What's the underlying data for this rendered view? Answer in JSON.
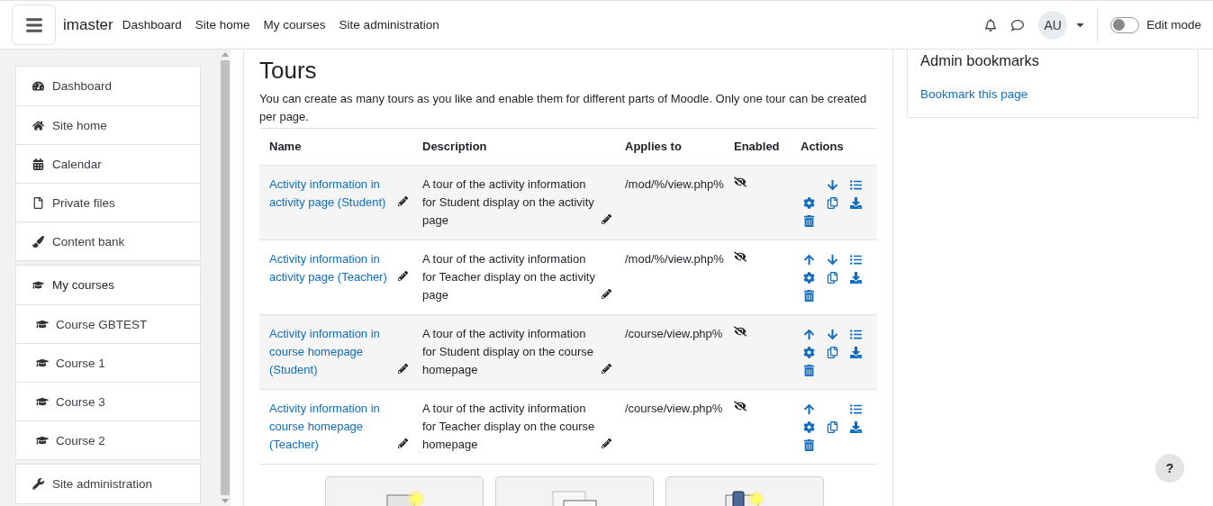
{
  "navbar": {
    "brand": "imaster",
    "links": [
      "Dashboard",
      "Site home",
      "My courses",
      "Site administration"
    ],
    "user_initials": "AU",
    "edit_mode": {
      "label": "Edit mode",
      "on": false
    }
  },
  "sidebar": {
    "groups": [
      {
        "items": [
          {
            "label": "Dashboard"
          },
          {
            "label": "Site home"
          },
          {
            "label": "Calendar"
          },
          {
            "label": "Private files"
          },
          {
            "label": "Content bank"
          }
        ]
      },
      {
        "items": [
          {
            "label": "My courses",
            "children": [
              {
                "label": "Course GBTEST"
              },
              {
                "label": "Course 1"
              },
              {
                "label": "Course 3"
              },
              {
                "label": "Course 2"
              }
            ]
          }
        ]
      },
      {
        "items": [
          {
            "label": "Site administration"
          }
        ]
      }
    ]
  },
  "page": {
    "title": "Tours",
    "intro": "You can create as many tours as you like and enable them for different parts of Moodle. Only one tour can be created per page.",
    "table": {
      "columns": [
        "Name",
        "Description",
        "Applies to",
        "Enabled",
        "Actions"
      ],
      "rows": [
        {
          "name": "Activity information in activity page (Student)",
          "description": "A tour of the activity information for Student display on the activity page",
          "applies_to": "/mod/%/view.php%",
          "enabled": false,
          "actions": [
            {
              "kind": "down"
            },
            {
              "kind": "list"
            },
            {
              "kind": "gear"
            },
            {
              "kind": "copy"
            },
            {
              "kind": "download"
            },
            {
              "kind": "trash"
            }
          ]
        },
        {
          "name": "Activity information in activity page (Teacher)",
          "description": "A tour of the activity information for Teacher display on the activity page",
          "applies_to": "/mod/%/view.php%",
          "enabled": false,
          "actions": [
            {
              "kind": "up"
            },
            {
              "kind": "down"
            },
            {
              "kind": "list"
            },
            {
              "kind": "gear"
            },
            {
              "kind": "copy"
            },
            {
              "kind": "download"
            },
            {
              "kind": "trash"
            }
          ]
        },
        {
          "name": "Activity information in course homepage (Student)",
          "description": "A tour of the activity information for Student display on the course homepage",
          "applies_to": "/course/view.php%",
          "enabled": false,
          "actions": [
            {
              "kind": "up"
            },
            {
              "kind": "down"
            },
            {
              "kind": "list"
            },
            {
              "kind": "gear"
            },
            {
              "kind": "copy"
            },
            {
              "kind": "download"
            },
            {
              "kind": "trash"
            }
          ]
        },
        {
          "name": "Activity information in course homepage (Teacher)",
          "description": "A tour of the activity information for Teacher display on the course homepage",
          "applies_to": "/course/view.php%",
          "enabled": false,
          "actions": [
            {
              "kind": "up"
            },
            {
              "kind": "list"
            },
            {
              "kind": "gear"
            },
            {
              "kind": "copy"
            },
            {
              "kind": "download"
            },
            {
              "kind": "trash"
            }
          ]
        }
      ]
    },
    "tiles": [
      {
        "kind": "new"
      },
      {
        "kind": "import"
      },
      {
        "kind": "library"
      }
    ]
  },
  "bookmarks": {
    "title": "Admin bookmarks",
    "link": "Bookmark this page"
  },
  "help": {
    "label": "?"
  }
}
